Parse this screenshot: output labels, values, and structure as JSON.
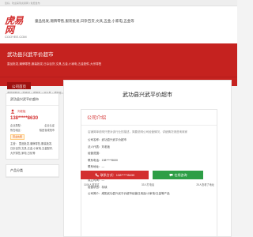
{
  "topbar": {
    "text": "您好，欢迎来到虎易网 | 免费发布"
  },
  "header": {
    "logo_main": "虎易网",
    "logo_sub": "COOYEE.COM",
    "site_desc": "童品批发,潮牌零售,服装批发,日杂百货,文具,五金,小家电,五金等"
  },
  "banner": {
    "title": "武功县兴武平价超市",
    "desc": "童品批发,潮牌零售,服装批发,日杂百货,文具,五金,小家电,五金配件,大宗零售"
  },
  "nav": {
    "item": "公司首页"
  },
  "breadcrumb": {
    "path": "虎易网首页 > 陕西省 > 咸阳市 > 武功县 > 咸阳市 > 商贸公司 > 武功县兴武平价超市",
    "time": "更新时间:2020-04-06 16:26:52"
  },
  "sidebar": {
    "company": "武功县兴武平价超市",
    "contact": "刘老板",
    "phone": "138*****8630",
    "rows": [
      {
        "label": "企业类型：",
        "value": "企业认证"
      },
      {
        "label": "所在地区：",
        "value": "陕西省咸阳市"
      }
    ],
    "badge": "营业执照",
    "scope_label": "主营：",
    "scope": "童品批发,潮牌零售,服装批发,日杂百货,文具,五金,小家电,五金配件,大宗零售,家电,日化等",
    "products_title": "产品分类"
  },
  "main": {
    "title": "武功县兴武平价超市",
    "intro_title": "公司介绍",
    "intro_lines": [
      "店铺简单说明只是对该行业的描述，简要说明公司经营情况，详细情况请咨询商家",
      "公司名称：武功县兴武平价超市",
      "法人代表：刘老板",
      "经营范围：",
      "联系电话：138*****8630",
      "联系地址：---",
      "注册资金：---",
      "成立时间：---",
      "经营状态：存续",
      "公司简介：咸阳武功县兴武平价超市经营日用品/小家电/五金等产品"
    ],
    "btn_phone": "联系方式：138*****8630",
    "btn_wechat": "在线咨询"
  },
  "stats": [
    "1106人浏览过",
    "33人打电话",
    "25人查看了地址"
  ],
  "colors": {
    "brand_red": "#c5221f",
    "green": "#2e9e46"
  }
}
